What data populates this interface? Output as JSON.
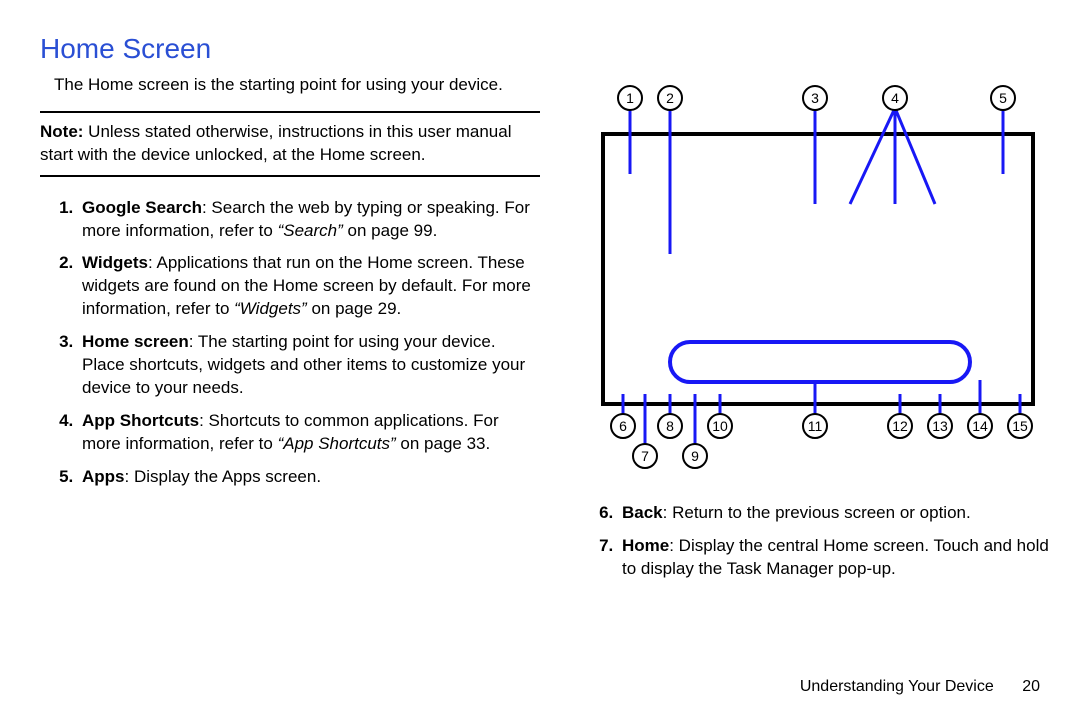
{
  "title": "Home Screen",
  "intro": "The Home screen is the starting point for using your device.",
  "note_label": "Note:",
  "note_body": " Unless stated otherwise, instructions in this user manual start with the device unlocked, at the Home screen.",
  "items_left": [
    {
      "name": "Google Search",
      "body": ": Search the web by typing or speaking. For more information, refer to ",
      "xref": "“Search”",
      "tail": " on page 99."
    },
    {
      "name": "Widgets",
      "body": ": Applications that run on the Home screen. These widgets are found on the Home screen by default. For more information, refer to ",
      "xref": "“Widgets”",
      "tail": " on page 29."
    },
    {
      "name": "Home screen",
      "body": ": The starting point for using your device. Place shortcuts, widgets and other items to customize your device to your needs.",
      "xref": "",
      "tail": ""
    },
    {
      "name": "App Shortcuts",
      "body": ": Shortcuts to common applications. For more information, refer to ",
      "xref": "“App Shortcuts”",
      "tail": " on page 33."
    },
    {
      "name": "Apps",
      "body": ": Display the Apps screen.",
      "xref": "",
      "tail": ""
    }
  ],
  "items_right": [
    {
      "name": "Back",
      "body": ": Return to the previous screen or option.",
      "xref": "",
      "tail": ""
    },
    {
      "name": "Home",
      "body": ": Display the central Home screen. Touch and hold to display the Task Manager pop-up.",
      "xref": "",
      "tail": ""
    }
  ],
  "callouts_top": [
    "1",
    "2",
    "3",
    "4",
    "5"
  ],
  "callouts_bot_r1": [
    "6",
    "8",
    "10",
    "11",
    "12",
    "13",
    "14",
    "15"
  ],
  "callouts_bot_r2": [
    "7",
    "9"
  ],
  "footer_section": "Understanding Your Device",
  "footer_page": "20"
}
